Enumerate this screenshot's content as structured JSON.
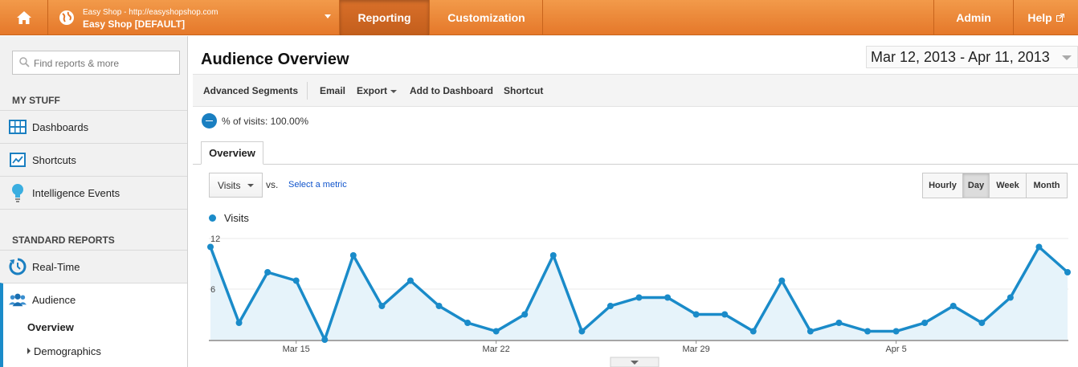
{
  "topbar": {
    "account_url": "Easy Shop - http://easyshopshop.com",
    "account_name": "Easy Shop [DEFAULT]",
    "tabs": [
      {
        "label": "Reporting"
      },
      {
        "label": "Customization"
      }
    ],
    "admin_label": "Admin",
    "help_label": "Help"
  },
  "sidebar": {
    "search_placeholder": "Find reports & more",
    "my_stuff_heading": "MY STUFF",
    "my_stuff_items": [
      {
        "label": "Dashboards",
        "icon": "dashboard-grid-icon"
      },
      {
        "label": "Shortcuts",
        "icon": "shortcut-icon"
      },
      {
        "label": "Intelligence Events",
        "icon": "lightbulb-icon"
      }
    ],
    "standard_heading": "STANDARD REPORTS",
    "standard_items": [
      {
        "label": "Real-Time",
        "icon": "realtime-icon"
      },
      {
        "label": "Audience",
        "icon": "people-icon"
      }
    ],
    "audience_sub": {
      "overview": "Overview",
      "demographics": "Demographics"
    }
  },
  "main": {
    "title": "Audience Overview",
    "date_range": "Mar 12, 2013 - Apr 11, 2013",
    "toolbar": {
      "advanced_segments": "Advanced Segments",
      "email": "Email",
      "export": "Export",
      "add_to_dashboard": "Add to Dashboard",
      "shortcut": "Shortcut"
    },
    "segment_text": "% of visits: 100.00%",
    "overview_tab": "Overview",
    "metric_select": "Visits",
    "vs_label": "vs.",
    "select_metric_link": "Select a metric",
    "granularity": [
      "Hourly",
      "Day",
      "Week",
      "Month"
    ],
    "granularity_selected": "Day",
    "legend_label": "Visits"
  },
  "colors": {
    "topbar": "#e98a3a",
    "accent": "#1a8bc9",
    "area_fill": "#e6f3fa"
  },
  "chart_data": {
    "type": "area",
    "series": [
      {
        "name": "Visits",
        "values": [
          11,
          2,
          8,
          7,
          0,
          10,
          4,
          7,
          4,
          2,
          1,
          3,
          10,
          1,
          4,
          5,
          5,
          3,
          3,
          1,
          7,
          1,
          2,
          1,
          1,
          2,
          4,
          2,
          5,
          11,
          8
        ]
      }
    ],
    "x_ticks": [
      {
        "index": 3,
        "label": "Mar 15"
      },
      {
        "index": 10,
        "label": "Mar 22"
      },
      {
        "index": 17,
        "label": "Mar 29"
      },
      {
        "index": 24,
        "label": "Apr 5"
      }
    ],
    "y_ticks": [
      12,
      6
    ],
    "ylim": [
      0,
      12
    ]
  }
}
